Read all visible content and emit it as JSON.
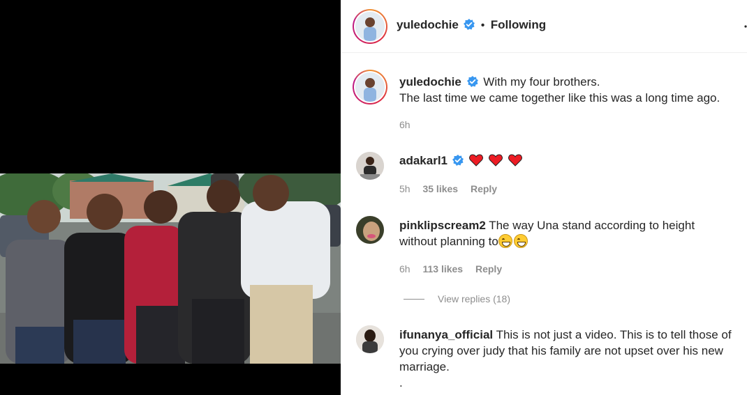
{
  "post": {
    "author": "yuledochie",
    "follow_status": "Following",
    "separator": "•",
    "more_icon": "more-dots-icon"
  },
  "caption": {
    "username": "yuledochie",
    "line1": "With my four brothers.",
    "line2": "The last time we came together like this was a long time ago.",
    "time": "6h"
  },
  "comments": [
    {
      "username": "adakarl1",
      "verified": true,
      "text": "",
      "hearts": 3,
      "time": "5h",
      "likes": "35 likes",
      "reply": "Reply"
    },
    {
      "username": "pinklipscream2",
      "verified": false,
      "text_line1": "The way Una stand according to height",
      "text_line2": "without planning to",
      "emojis": 2,
      "time": "6h",
      "likes": "113 likes",
      "reply": "Reply",
      "view_replies": "View replies (18)"
    },
    {
      "username": "ifunanya_official",
      "verified": false,
      "text_line1": "This is not just a video. This is to tell those of",
      "text_line2": "you crying over judy that his family are not upset over his new",
      "text_line3": "marriage.",
      "text_line4": "."
    }
  ],
  "colors": {
    "verified_blue": "#3897f0",
    "heart_red": "#ed1c24",
    "muted_text": "#8e8e8e"
  }
}
